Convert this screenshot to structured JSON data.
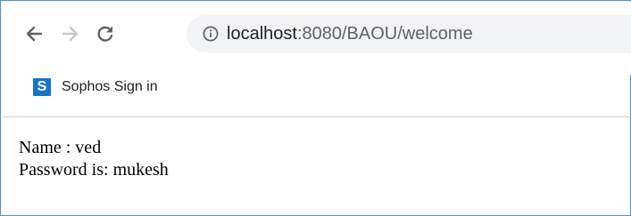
{
  "browser": {
    "back_icon": "arrow-left-icon",
    "forward_icon": "arrow-right-icon",
    "reload_icon": "reload-icon",
    "site_info_icon": "info-icon",
    "url_host": "localhost",
    "url_rest": ":8080/BAOU/welcome"
  },
  "bookmarks": [
    {
      "icon_letter": "S",
      "icon_color": "#1a73c8",
      "label": "Sophos Sign in"
    }
  ],
  "page": {
    "lines": [
      "Name : ved",
      "Password is: mukesh"
    ]
  }
}
